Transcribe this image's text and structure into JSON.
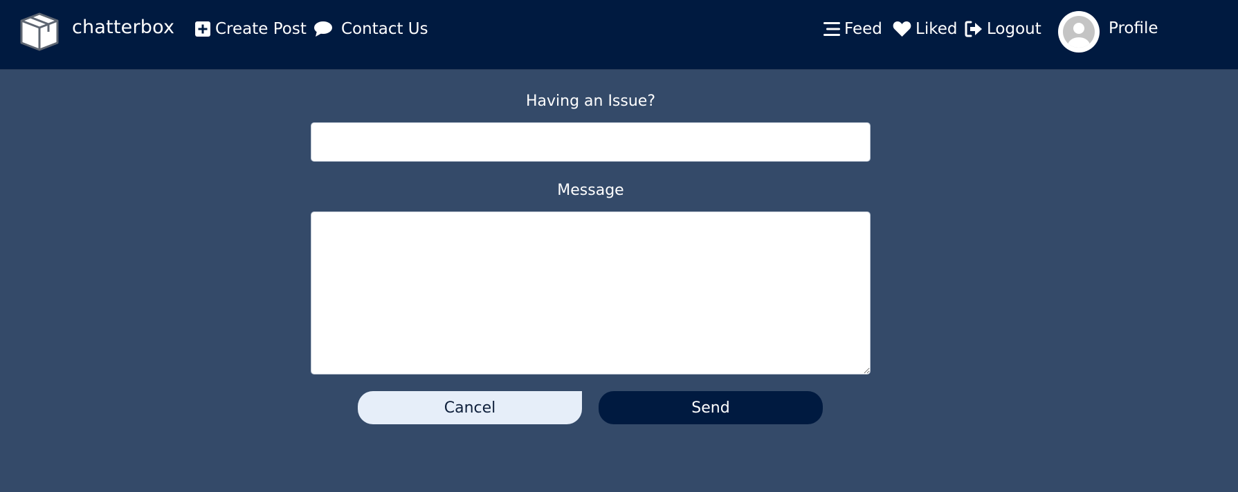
{
  "navbar": {
    "brand": "chatterbox",
    "left_links": [
      {
        "label": "Create Post",
        "icon": "plus-square-icon"
      },
      {
        "label": "Contact Us",
        "icon": "comment-icon"
      }
    ],
    "right_links": [
      {
        "label": "Feed",
        "icon": "bars-icon"
      },
      {
        "label": "Liked",
        "icon": "heart-icon"
      },
      {
        "label": "Logout",
        "icon": "sign-out-icon"
      }
    ],
    "profile_label": "Profile"
  },
  "form": {
    "issue_label": "Having an Issue?",
    "issue_value": "",
    "message_label": "Message",
    "message_value": "",
    "cancel_label": "Cancel",
    "send_label": "Send"
  },
  "colors": {
    "navbar_bg": "#001a40",
    "page_bg": "#344a69",
    "cancel_bg": "#e6eef9",
    "send_bg": "#001a40"
  }
}
